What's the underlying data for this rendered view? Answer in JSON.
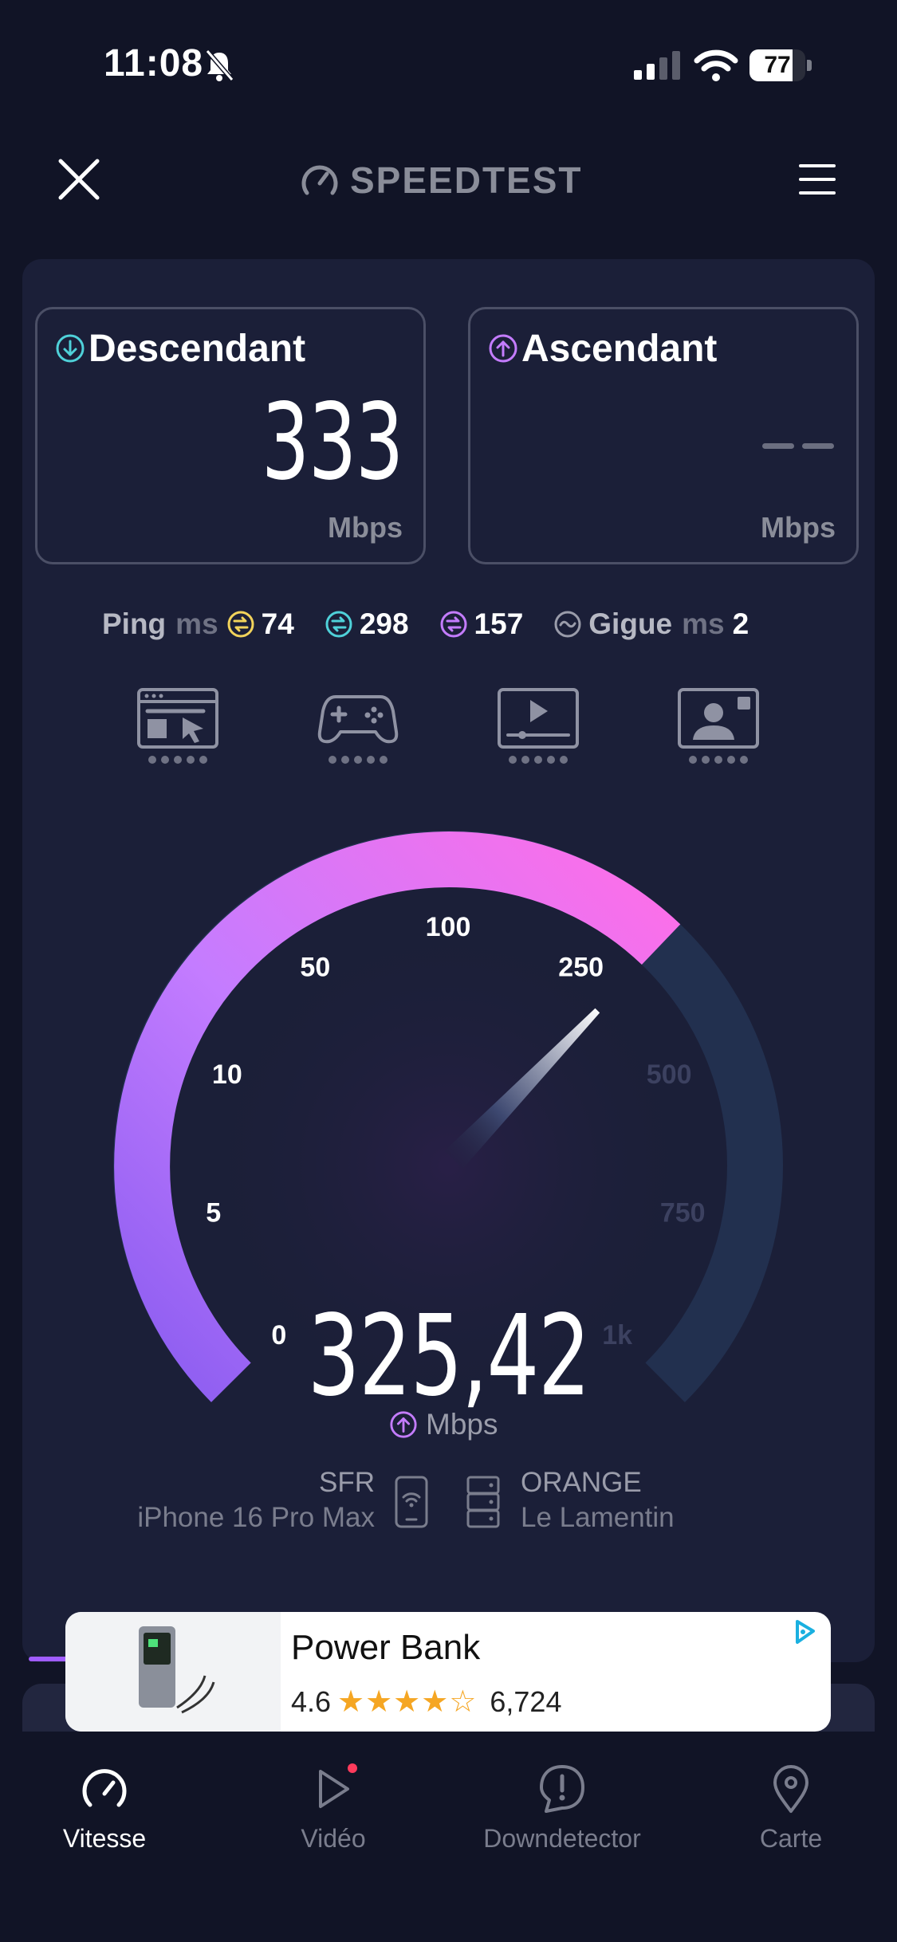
{
  "status_bar": {
    "time": "11:08",
    "battery": "77",
    "battery_level": 0.77
  },
  "header": {
    "logo_text": "SPEEDTEST",
    "close_icon": "close-icon",
    "menu_icon": "menu-icon"
  },
  "download": {
    "title": "Descendant",
    "value": "333",
    "unit": "Mbps"
  },
  "upload": {
    "title": "Ascendant",
    "value": "– –",
    "unit": "Mbps"
  },
  "ping": {
    "label": "Ping",
    "unit": "ms",
    "idle": "74",
    "download": "298",
    "upload": "157",
    "jitter_label": "Gigue",
    "jitter_unit": "ms",
    "jitter": "2"
  },
  "quality_icons": [
    "browsing-icon",
    "gaming-icon",
    "video-streaming-icon",
    "video-call-icon"
  ],
  "gauge": {
    "ticks": [
      "0",
      "5",
      "10",
      "50",
      "100",
      "250",
      "500",
      "750",
      "1k"
    ],
    "current_value": "325,42",
    "unit": "Mbps",
    "needle_mbps": 325.42
  },
  "provider": {
    "isp": "SFR",
    "device": "iPhone 16 Pro Max",
    "server_name": "ORANGE",
    "server_location": "Le Lamentin"
  },
  "ad": {
    "title": "Power Bank",
    "rating": "4.6",
    "stars": "★★★★☆",
    "reviews": "6,724"
  },
  "nav": [
    {
      "label": "Vitesse",
      "icon": "speed-icon",
      "active": true
    },
    {
      "label": "Vidéo",
      "icon": "video-play-icon",
      "active": false
    },
    {
      "label": "Downdetector",
      "icon": "alert-icon",
      "active": false
    },
    {
      "label": "Carte",
      "icon": "map-pin-icon",
      "active": false
    }
  ],
  "colors": {
    "accent_purple": "#a05cff",
    "accent_pink": "#ff6ee8",
    "teal": "#4fd1d9",
    "yellow": "#f2d35b",
    "gauge_track": "#22304f"
  }
}
